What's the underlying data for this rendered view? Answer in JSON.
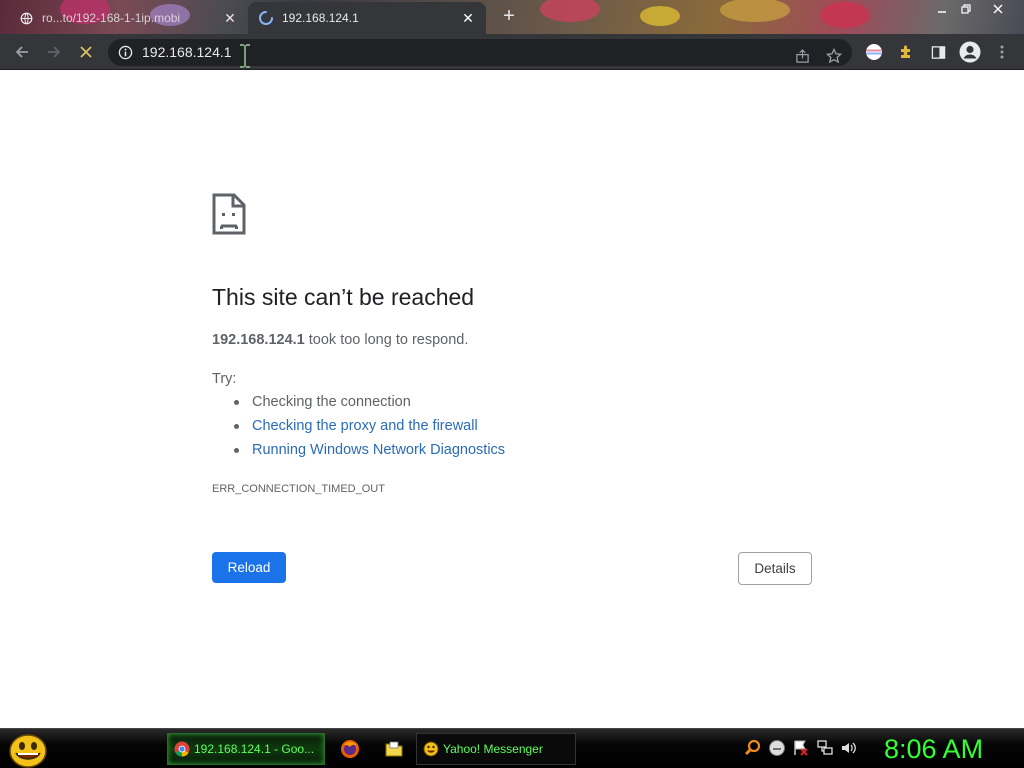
{
  "browser": {
    "tabs": [
      {
        "title": "ro...to/192-168-1-1ip.mobi",
        "state": "inactive",
        "favicon": "globe-icon"
      },
      {
        "title": "192.168.124.1",
        "state": "active",
        "favicon": "loading-spinner-icon"
      }
    ],
    "new_tab_label": "+",
    "address": "192.168.124.1",
    "loading": true
  },
  "error_page": {
    "icon": "sad-document-icon",
    "heading": "This site can’t be reached",
    "host": "192.168.124.1",
    "summary_rest": " took too long to respond.",
    "try_label": "Try:",
    "suggestions": [
      {
        "text": "Checking the connection",
        "is_link": false
      },
      {
        "text": "Checking the proxy and the firewall",
        "is_link": true
      },
      {
        "text": "Running Windows Network Diagnostics",
        "is_link": true
      }
    ],
    "error_code": "ERR_CONNECTION_TIMED_OUT",
    "reload_label": "Reload",
    "details_label": "Details"
  },
  "taskbar": {
    "tasks": [
      {
        "label": "192.168.124.1 - Goo...",
        "app": "chrome-icon",
        "active": true
      },
      {
        "label": "Yahoo! Messenger",
        "app": "yahoo-messenger-icon",
        "active": false
      }
    ],
    "quick_launch": [
      "firefox-icon",
      "folder-icon"
    ],
    "tray": [
      "search-icon",
      "messenger-tray-icon",
      "flag-icon",
      "network-icon",
      "volume-icon"
    ],
    "clock": "8:06 AM"
  },
  "colors": {
    "accent_blue": "#1a73e8",
    "link_blue": "#2a6cb8",
    "toolbar_dark": "#35363a",
    "clock_green": "#33ff33"
  }
}
